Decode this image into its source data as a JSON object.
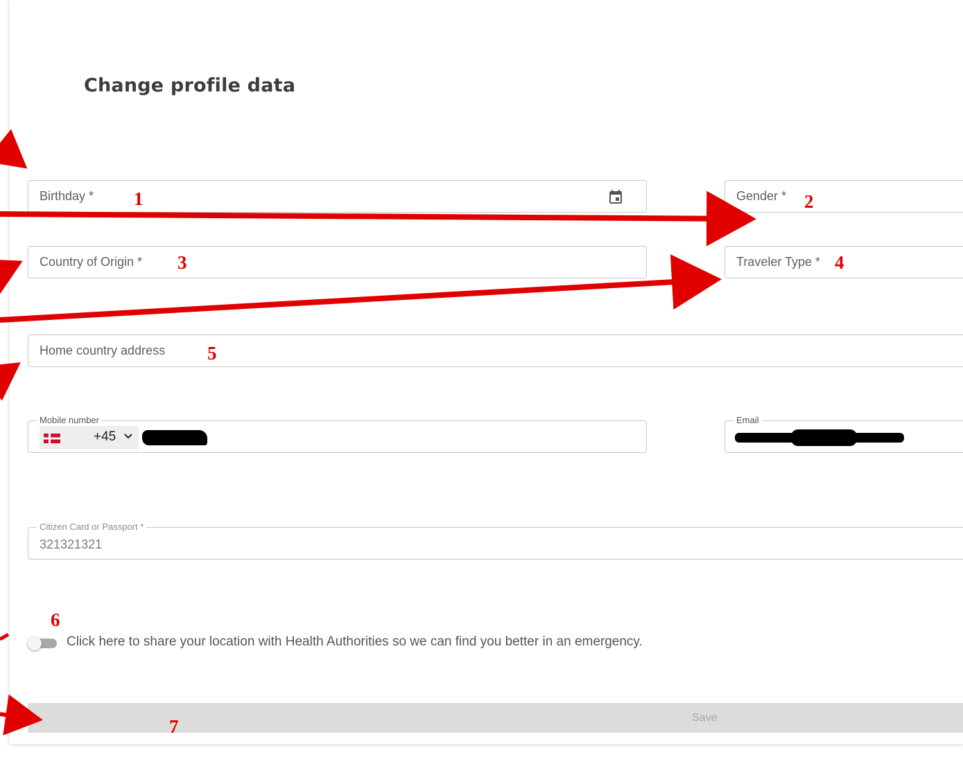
{
  "page": {
    "title": "Change profile data"
  },
  "form": {
    "birthday": {
      "label": "Birthday *"
    },
    "gender": {
      "label": "Gender *"
    },
    "country_of_origin": {
      "label": "Country of Origin *"
    },
    "traveler_type": {
      "label": "Traveler Type *"
    },
    "home_address": {
      "label": "Home country address"
    },
    "mobile": {
      "label": "Mobile number",
      "dial_code": "+45",
      "flag_icon": "denmark-flag-icon"
    },
    "email": {
      "label": "Email"
    },
    "passport": {
      "label": "Citizen Card or Passport *",
      "value": "321321321"
    },
    "location_toggle": {
      "text": "Click here to share your location with Health Authorities so we can find you better in an emergency.",
      "checked": false
    },
    "save_label": "Save"
  },
  "annotations": {
    "numbers": [
      "1",
      "2",
      "3",
      "4",
      "5",
      "6",
      "7"
    ],
    "color": "#e00000"
  },
  "colors": {
    "field_border": "#c8c8c8",
    "save_bar": "#dcdcdc",
    "annotation": "#e00000"
  }
}
